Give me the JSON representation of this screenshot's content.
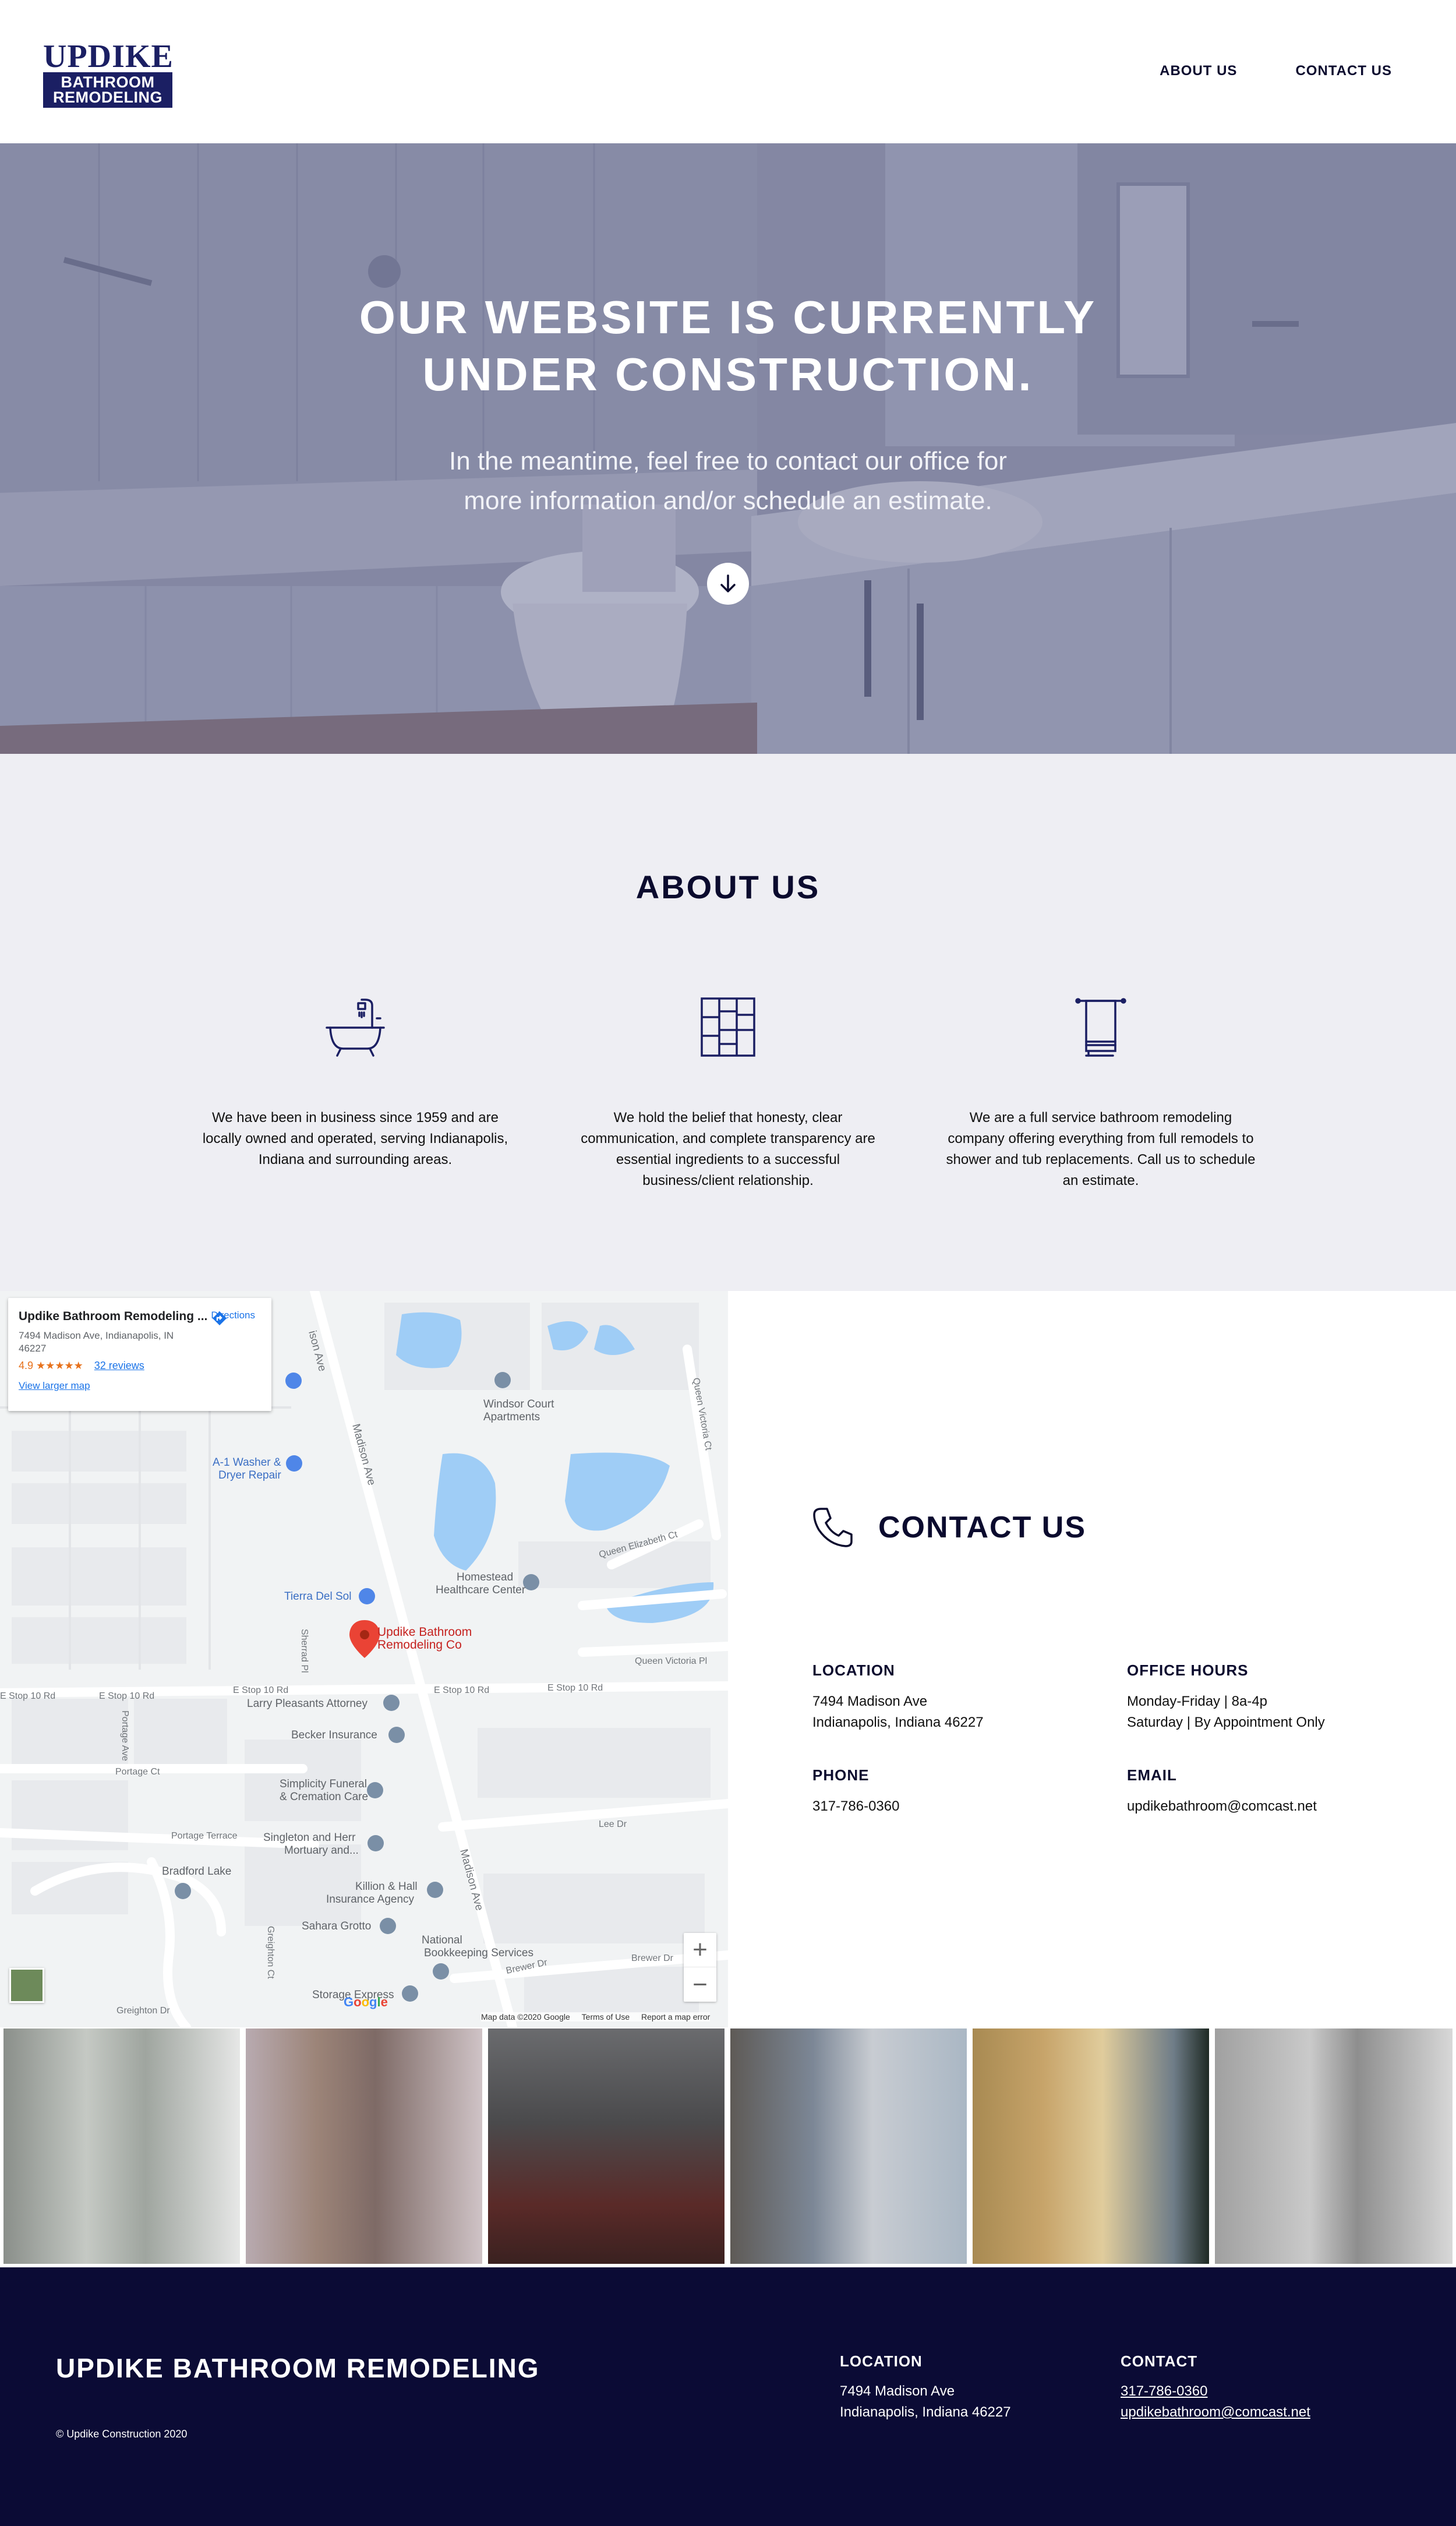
{
  "header": {
    "logo": {
      "line1": "UPDIKE",
      "line2": "BATHROOM",
      "line3": "REMODELING"
    },
    "nav": [
      {
        "label": "ABOUT US"
      },
      {
        "label": "CONTACT US"
      }
    ]
  },
  "hero": {
    "title_line1": "OUR WEBSITE IS CURRENTLY",
    "title_line2": "UNDER CONSTRUCTION.",
    "subtitle_line1": "In the meantime, feel free to contact our office for",
    "subtitle_line2": "more information and/or schedule an estimate.",
    "arrow_icon": "arrow-down-icon"
  },
  "about": {
    "title": "ABOUT US",
    "columns": [
      {
        "icon": "bathtub-icon",
        "text": "We have been in business since 1959 and are locally owned and operated, serving Indianapolis, Indiana and surrounding areas."
      },
      {
        "icon": "tile-icon",
        "text": "We hold the belief that honesty, clear communication, and complete transparency are essential ingredients to a successful business/client relationship."
      },
      {
        "icon": "towel-rack-icon",
        "text": "We are a full service bathroom remodeling company offering everything from full remodels to shower and tub replacements. Call us to schedule an estimate."
      }
    ]
  },
  "map": {
    "card": {
      "title": "Updike Bathroom Remodeling ...",
      "address": "7494 Madison Ave, Indianapolis, IN 46227",
      "rating": "4.9",
      "stars": "★★★★★",
      "reviews": "32 reviews",
      "larger": "View larger map",
      "directions": "Directions"
    },
    "labels": {
      "marker": "Updike Bathroom Remodeling Co",
      "windsor": "Windsor Court Apartments",
      "washer": "A-1 Washer & Dryer Repair",
      "homestead": "Homestead Healthcare Center",
      "tierra": "Tierra Del Sol",
      "larry": "Larry Pleasants Attorney",
      "becker": "Becker Insurance",
      "simplicity": "Simplicity Funeral & Cremation Care",
      "singleton": "Singleton and Herr Mortuary and...",
      "killion": "Killion & Hall Insurance Agency",
      "sahara": "Sahara Grotto",
      "national": "National Bookkeeping Services",
      "storage": "Storage Express",
      "bradford": "Bradford Lake",
      "madison": "Madison Ave",
      "estop": "E Stop 10 Rd",
      "portage_ct": "Portage Ct",
      "portage_terrace": "Portage Terrace",
      "portage_ave": "Portage Ave",
      "queen_vic_pl": "Queen Victoria Pl",
      "queen_vic_ct": "Queen Victoria Ct",
      "queen_eliz": "Queen Elizabeth Ct",
      "lee": "Lee Dr",
      "brewer": "Brewer Dr",
      "shorted": "Sherrad Pl",
      "greighton_ct": "Greighton Ct",
      "greighton_dr": "Greighton Dr"
    },
    "zoom_in": "+",
    "zoom_out": "−",
    "google": "Google",
    "map_data": "Map data ©2020 Google",
    "terms": "Terms of Use",
    "report": "Report a map error"
  },
  "contact": {
    "title": "CONTACT US",
    "icon": "phone-icon",
    "location_label": "LOCATION",
    "location_line1": "7494 Madison Ave",
    "location_line2": "Indianapolis, Indiana 46227",
    "hours_label": "OFFICE HOURS",
    "hours_line1": "Monday-Friday | 8a-4p",
    "hours_line2": "Saturday | By Appointment Only",
    "phone_label": "PHONE",
    "phone": "317-786-0360",
    "email_label": "EMAIL",
    "email": "updikebathroom@comcast.net"
  },
  "footer": {
    "brand": "UPDIKE BATHROOM REMODELING",
    "copyright": "© Updike Construction 2020",
    "location_label": "LOCATION",
    "location_line1": "7494 Madison Ave",
    "location_line2": "Indianapolis, Indiana 46227",
    "contact_label": "CONTACT",
    "phone": "317-786-0360",
    "email": "updikebathroom@comcast.net"
  },
  "colors": {
    "navy": "#0b0b35",
    "brand_blue": "#1b1f63",
    "about_bg": "#eeeef3",
    "hero_overlay": "#7a7f9e",
    "map_water": "#9fcdf6",
    "map_link": "#1a73e8",
    "marker_red": "#ea4335"
  }
}
